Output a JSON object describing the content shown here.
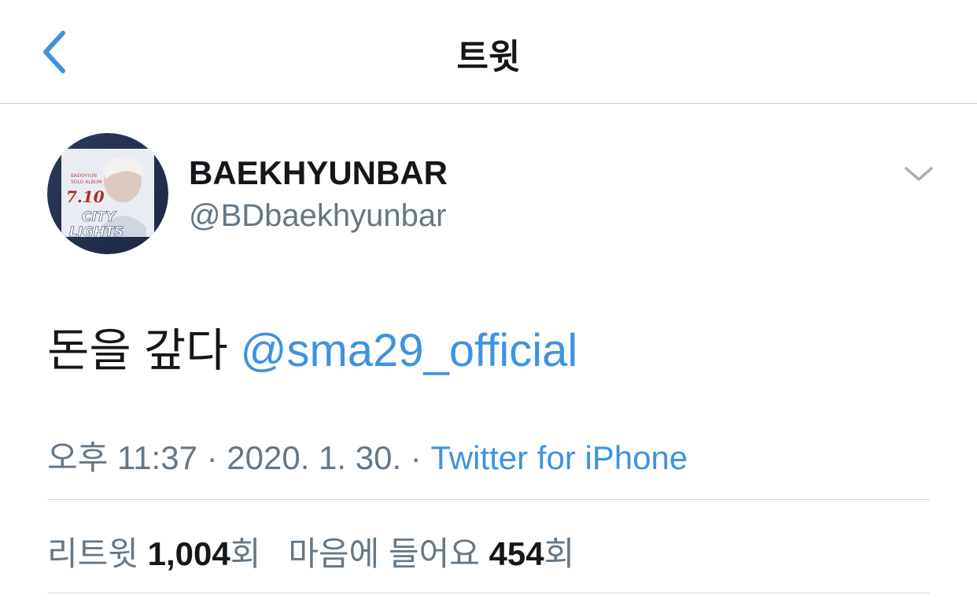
{
  "nav": {
    "title": "트윗",
    "back_icon": "chevron-left-icon",
    "accent_color": "#3f92e0"
  },
  "author": {
    "display_name": "BAEKHYUNBAR",
    "handle": "@BDbaekhyunbar",
    "avatar": {
      "date_text": "7.10",
      "album_line1": "BAEKHYUN",
      "album_line2": "SOLO ALBUM",
      "title_line1": "CITY",
      "title_line2": "LIGHTS"
    },
    "more_icon": "chevron-down-icon"
  },
  "tweet": {
    "text": "돈을 갚다 ",
    "mention": "@sma29_official"
  },
  "meta": {
    "time": "오후 11:37",
    "sep1": " · ",
    "date": "2020. 1. 30.",
    "sep2": " · ",
    "source": "Twitter for iPhone"
  },
  "stats": {
    "retweets_label": "리트윗 ",
    "retweets_count": "1,004",
    "retweets_unit": "회",
    "likes_label": "마음에 들어요 ",
    "likes_count": "454",
    "likes_unit": "회"
  }
}
